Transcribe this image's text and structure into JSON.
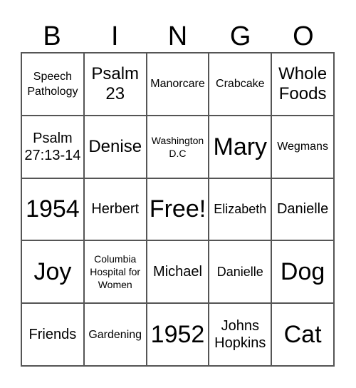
{
  "header": {
    "letters": [
      "B",
      "I",
      "N",
      "G",
      "O"
    ]
  },
  "cells": [
    {
      "text": "Speech Pathology",
      "size": "s-sm"
    },
    {
      "text": "Psalm 23",
      "size": "s-lg"
    },
    {
      "text": "Manorcare",
      "size": "s-sm"
    },
    {
      "text": "Crabcake",
      "size": "s-sm"
    },
    {
      "text": "Whole Foods",
      "size": "s-lg"
    },
    {
      "text": "Psalm 27:13-14",
      "size": "s-mid"
    },
    {
      "text": "Denise",
      "size": "s-lg"
    },
    {
      "text": "Washington D.C",
      "size": "s-xs"
    },
    {
      "text": "Mary",
      "size": "s-xxl"
    },
    {
      "text": "Wegmans",
      "size": "s-sm"
    },
    {
      "text": "1954",
      "size": "s-xxl"
    },
    {
      "text": "Herbert",
      "size": "s-mid"
    },
    {
      "text": "Free!",
      "size": "s-xxl"
    },
    {
      "text": "Elizabeth",
      "size": "s-md"
    },
    {
      "text": "Danielle",
      "size": "s-mid"
    },
    {
      "text": "Joy",
      "size": "s-xxl"
    },
    {
      "text": "Columbia Hospital for Women",
      "size": "s-xs"
    },
    {
      "text": "Michael",
      "size": "s-mid"
    },
    {
      "text": "Danielle",
      "size": "s-md"
    },
    {
      "text": "Dog",
      "size": "s-xxl"
    },
    {
      "text": "Friends",
      "size": "s-mid"
    },
    {
      "text": "Gardening",
      "size": "s-sm"
    },
    {
      "text": "1952",
      "size": "s-xxl"
    },
    {
      "text": "Johns Hopkins",
      "size": "s-mid"
    },
    {
      "text": "Cat",
      "size": "s-xxl"
    }
  ]
}
